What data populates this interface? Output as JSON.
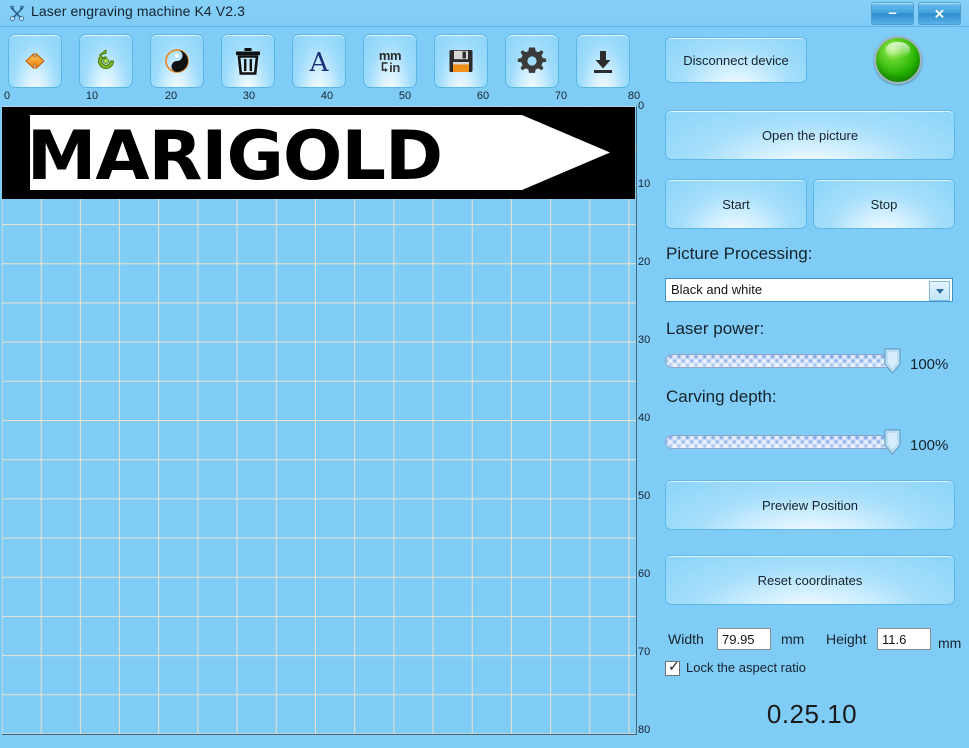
{
  "window": {
    "title": "Laser engraving machine K4 V2.3",
    "icon": "tools-icon",
    "minimize_label": "–",
    "close_label": "✕"
  },
  "toolbar": {
    "buttons": [
      {
        "name": "flip-horizontal-button",
        "icon": "flip-horizontal-icon",
        "label": ""
      },
      {
        "name": "rotate-button",
        "icon": "rotate-counterclockwise-icon",
        "label": ""
      },
      {
        "name": "invert-colors-button",
        "icon": "yin-yang-invert-icon",
        "label": ""
      },
      {
        "name": "delete-button",
        "icon": "trash-icon",
        "label": ""
      },
      {
        "name": "text-button",
        "icon": "letter-a-icon",
        "label": ""
      },
      {
        "name": "unit-convert-button",
        "icon": "mm-to-in-icon",
        "label_top": "mm",
        "label_bottom": "in"
      },
      {
        "name": "save-button",
        "icon": "floppy-disk-icon",
        "label": ""
      },
      {
        "name": "settings-button",
        "icon": "gear-icon",
        "label": ""
      },
      {
        "name": "download-button",
        "icon": "download-icon",
        "label": ""
      }
    ]
  },
  "rulers": {
    "horizontal": [
      "0",
      "10",
      "20",
      "30",
      "40",
      "50",
      "60",
      "70",
      "80"
    ],
    "vertical": [
      "0",
      "10",
      "20",
      "30",
      "40",
      "50",
      "60",
      "70",
      "80"
    ],
    "unit": "mm"
  },
  "canvas": {
    "artwork_text": "MARIGOLD",
    "artwork_shape": "right-arrow-banner",
    "background_color": "#7fcdf7",
    "grid_line_color": "#ffe4c4"
  },
  "panel": {
    "disconnect_label": "Disconnect device",
    "status_led": {
      "name": "connection-status-led",
      "color": "#22b000",
      "state": "connected"
    },
    "open_picture_label": "Open the picture",
    "start_label": "Start",
    "stop_label": "Stop",
    "picture_processing": {
      "label": "Picture Processing:",
      "value": "Black and white",
      "options": [
        "Black and white"
      ]
    },
    "laser_power": {
      "label": "Laser power:",
      "value": "100%",
      "percent": 100
    },
    "carving_depth": {
      "label": "Carving depth:",
      "value": "100%",
      "percent": 100
    },
    "preview_position_label": "Preview Position",
    "reset_coordinates_label": "Reset coordinates",
    "dimensions": {
      "width_label": "Width",
      "width_value": "79.95",
      "width_unit": "mm",
      "height_label": "Height",
      "height_value": "11.6",
      "height_unit": "mm"
    },
    "lock_aspect": {
      "label": "Lock the aspect ratio",
      "checked": true,
      "check_glyph": "✓"
    },
    "version": "0.25.10"
  }
}
